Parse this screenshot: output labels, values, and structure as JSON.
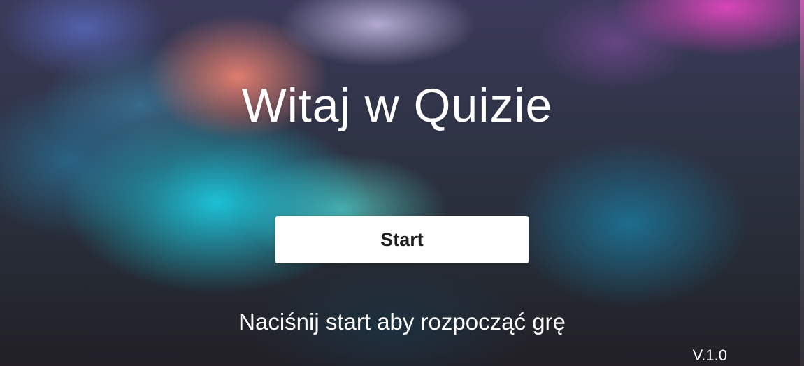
{
  "screen": {
    "title": "Witaj w Quizie",
    "start_label": "Start",
    "instruction": "Naciśnij start aby rozpocząć grę",
    "version": "V.1.0"
  },
  "colors": {
    "button_background": "#ffffff",
    "button_text": "#1e1e1e",
    "text": "#ffffff"
  }
}
